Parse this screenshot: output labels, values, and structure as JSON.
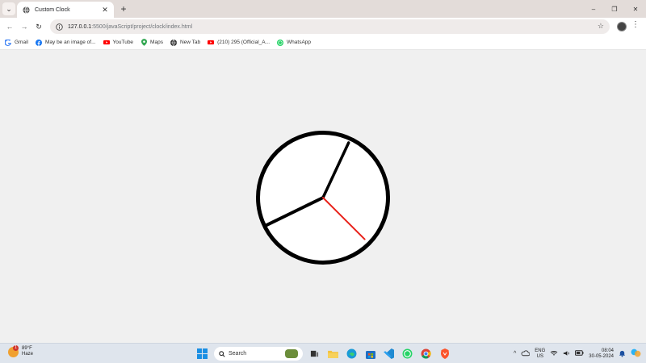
{
  "browser": {
    "tab": {
      "title": "Custom Clock",
      "close_glyph": "✕"
    },
    "new_tab_glyph": "+",
    "tab_search_glyph": "⌄",
    "window_controls": {
      "minimize": "–",
      "restore": "❐",
      "close": "✕"
    },
    "nav": {
      "back": "←",
      "forward": "→",
      "reload": "↻"
    },
    "address": {
      "host": "127.0.0.1",
      "path": ":5500/javaScript/project/clock/index.html"
    },
    "star_glyph": "☆",
    "menu_glyph": "⋮",
    "bookmarks": [
      {
        "label": "Gmail",
        "icon": "google-icon",
        "color": "#4285F4"
      },
      {
        "label": "May be an image of...",
        "icon": "facebook-icon",
        "color": "#1877F2"
      },
      {
        "label": "YouTube",
        "icon": "youtube-icon",
        "color": "#FF0000"
      },
      {
        "label": "Maps",
        "icon": "maps-icon",
        "color": "#34A853"
      },
      {
        "label": "New Tab",
        "icon": "globe-icon",
        "color": "#333333"
      },
      {
        "label": "(210) 295 (Official_A...",
        "icon": "youtube-icon",
        "color": "#FF0000"
      },
      {
        "label": "WhatsApp",
        "icon": "whatsapp-icon",
        "color": "#25D366"
      }
    ]
  },
  "clock": {
    "face_color": "#ffffff",
    "border_color": "#000000",
    "hands": {
      "hour": {
        "angle_deg": 244,
        "color": "#000000"
      },
      "minute": {
        "angle_deg": 25,
        "color": "#000000"
      },
      "second": {
        "angle_deg": 135,
        "color": "#e8221b"
      }
    }
  },
  "taskbar": {
    "weather": {
      "temp": "89°F",
      "condition": "Haze",
      "badge": "1"
    },
    "search_label": "Search",
    "tray": {
      "chevron": "^",
      "lang_top": "ENG",
      "lang_bottom": "US",
      "time": "08:04",
      "date": "30-05-2024"
    }
  }
}
